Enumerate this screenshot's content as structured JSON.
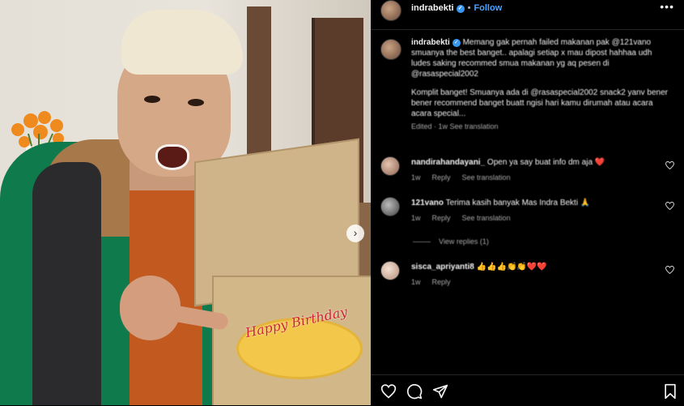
{
  "post": {
    "username": "indrabekti",
    "follow_label": "Follow",
    "separator": "•",
    "more_label": "•••",
    "carousel_next_label": "›",
    "caption_user": "indrabekti",
    "caption_text": "Memang gak pernah failed makanan pak @121vano smuanya the best banget.. apalagi setiap x mau dipost hahhaa udh ludes saking recommed smua makanan yg aq pesen di @rasaspecial2002",
    "caption_text_2": "Komplit banget! Smuanya ada di @rasaspecial2002 snack2 yanv bener bener recommend banget buatt ngisi hari kamu dirumah atau acara acara special...",
    "caption_meta": "Edited · 1w   See translation",
    "cake_topper": "Happy Birthday"
  },
  "comments": [
    {
      "username": "nandirahandayani_",
      "text": "Open ya say buat info dm aja ❤️",
      "time": "1w",
      "reply": "Reply",
      "translate": "See translation"
    },
    {
      "username": "121vano",
      "text": "Terima kasih banyak Mas Indra Bekti 🙏",
      "time": "1w",
      "reply": "Reply",
      "translate": "See translation"
    },
    {
      "username": "sisca_apriyanti8",
      "text": "👍👍👍👏👏❤️❤️",
      "time": "1w",
      "reply": "Reply",
      "translate": ""
    }
  ],
  "view_replies": "View replies (1)",
  "icons": [
    "heart-icon",
    "comment-icon",
    "share-icon",
    "bookmark-icon",
    "verified-badge-icon",
    "more-options-icon"
  ],
  "colors": {
    "background": "#000000",
    "follow": "#4aa3ff",
    "verified": "#3897f0",
    "muted": "#a8a8a8"
  }
}
